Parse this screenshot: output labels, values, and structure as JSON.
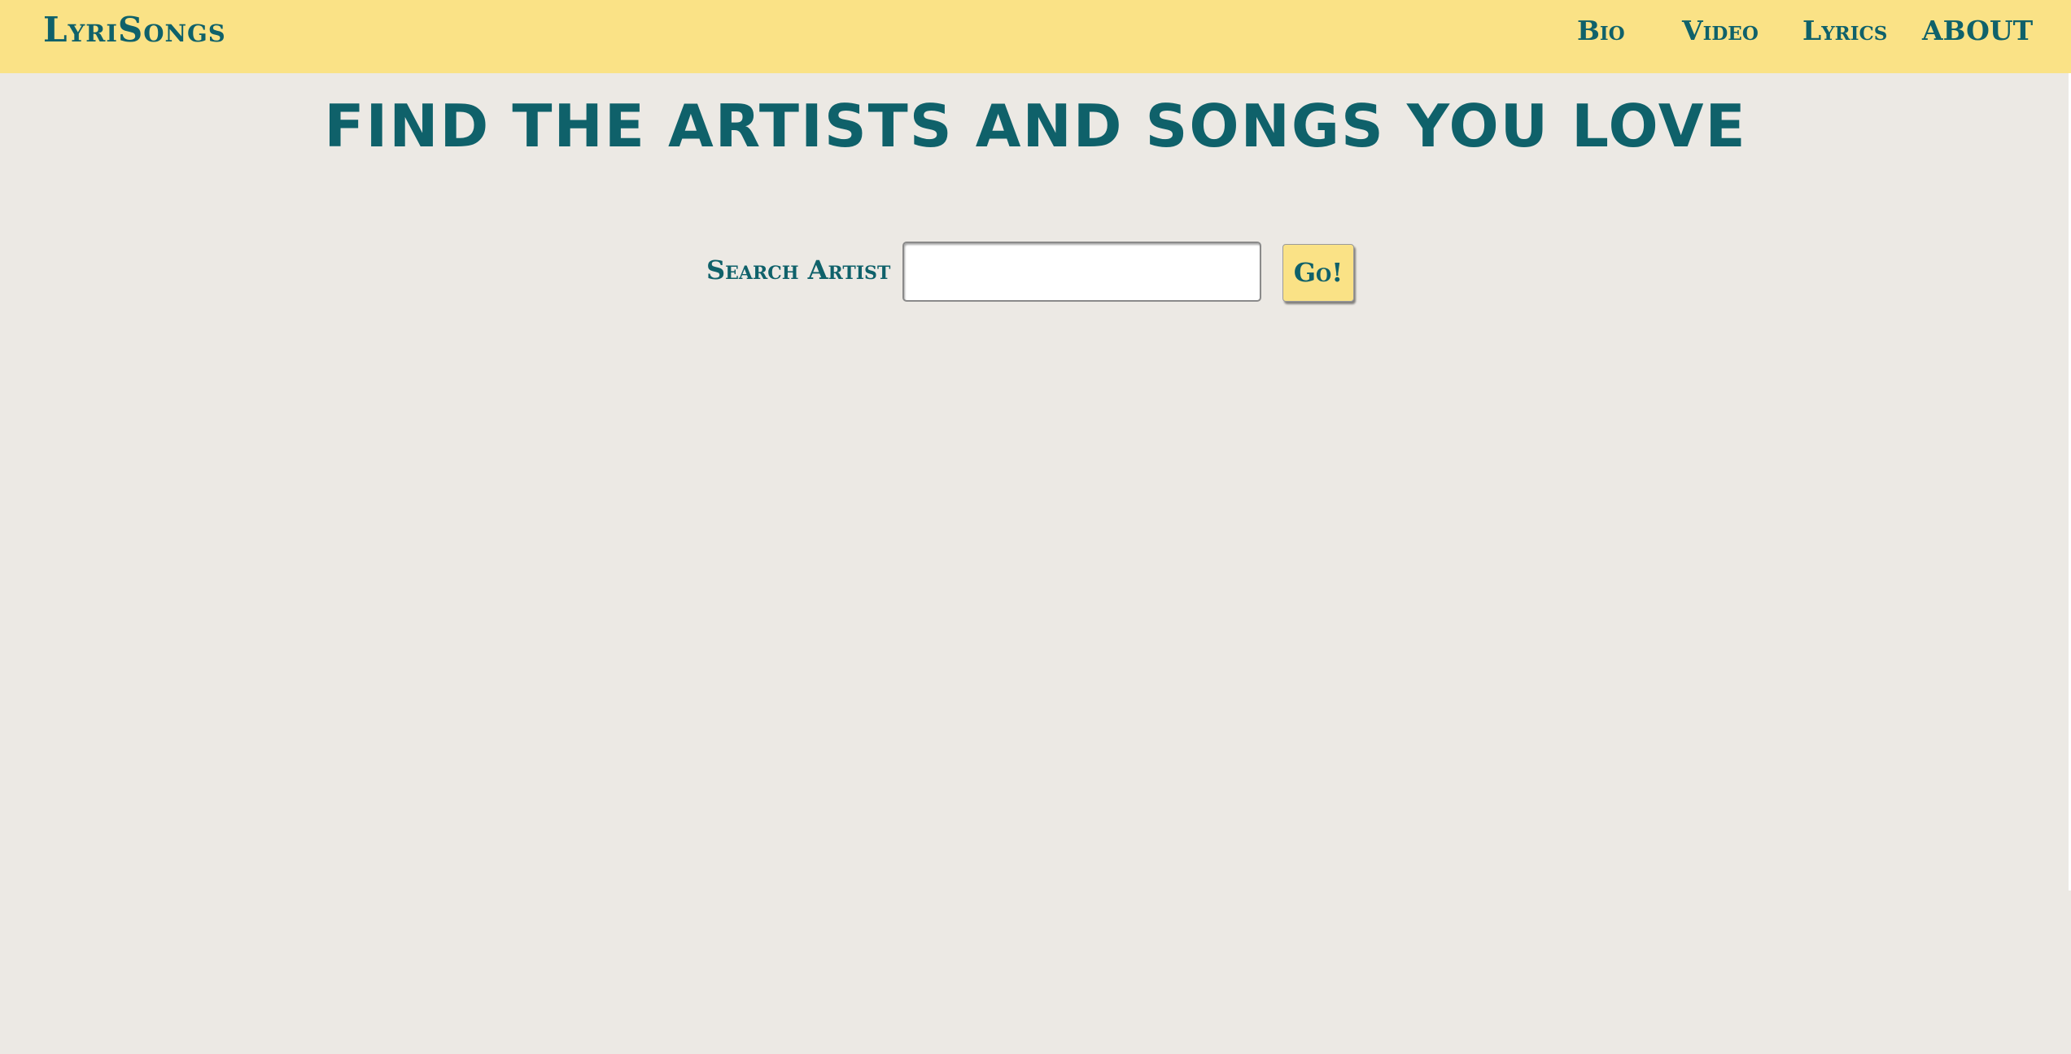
{
  "header": {
    "brand": "LyriSongs",
    "nav": [
      {
        "label": "Bio"
      },
      {
        "label": "Video"
      },
      {
        "label": "Lyrics"
      },
      {
        "label": "ABOUT"
      }
    ]
  },
  "main": {
    "headline": "FIND THE ARTISTS AND SONGS YOU LOVE",
    "search": {
      "label": "Search Artist",
      "value": "",
      "placeholder": "",
      "button_label": "Go!"
    }
  },
  "colors": {
    "header_bg": "#FAE286",
    "page_bg": "#ECE9E4",
    "accent_text": "#0F616A"
  }
}
